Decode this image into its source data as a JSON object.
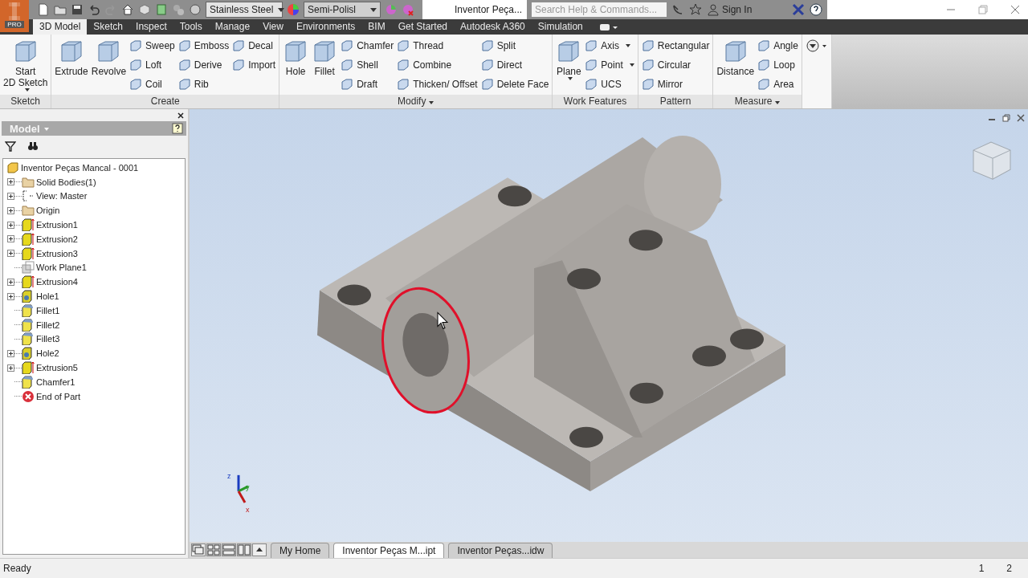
{
  "app": {
    "logo_badge": "PRO",
    "material": "Stainless Steel",
    "appearance": "Semi-Polisl",
    "title": "Inventor Peça...",
    "search_placeholder": "Search Help & Commands...",
    "sign_in": "Sign In"
  },
  "ribbon_tabs": [
    {
      "label": "3D Model",
      "selected": true
    },
    {
      "label": "Sketch",
      "selected": false
    },
    {
      "label": "Inspect",
      "selected": false
    },
    {
      "label": "Tools",
      "selected": false
    },
    {
      "label": "Manage",
      "selected": false
    },
    {
      "label": "View",
      "selected": false
    },
    {
      "label": "Environments",
      "selected": false
    },
    {
      "label": "BIM",
      "selected": false
    },
    {
      "label": "Get Started",
      "selected": false
    },
    {
      "label": "Autodesk A360",
      "selected": false
    },
    {
      "label": "Simulation",
      "selected": false
    }
  ],
  "ribbon_panels": [
    {
      "title": "Sketch",
      "menu": false,
      "tools": [
        {
          "label": "Start\n2D Sketch",
          "kind": "large",
          "dropdown": true
        }
      ]
    },
    {
      "title": "Create",
      "menu": false,
      "tools": [
        {
          "label": "Extrude",
          "kind": "large",
          "dropdown": false
        },
        {
          "label": "Revolve",
          "kind": "large",
          "dropdown": false
        },
        {
          "label": "Sweep",
          "kind": "small",
          "dropdown": false
        },
        {
          "label": "Loft",
          "kind": "small",
          "dropdown": false
        },
        {
          "label": "Coil",
          "kind": "small",
          "dropdown": false
        },
        {
          "label": "Emboss",
          "kind": "small",
          "dropdown": false
        },
        {
          "label": "Derive",
          "kind": "small",
          "dropdown": false
        },
        {
          "label": "Rib",
          "kind": "small",
          "dropdown": false
        },
        {
          "label": "Decal",
          "kind": "small",
          "dropdown": false
        },
        {
          "label": "Import",
          "kind": "small",
          "dropdown": false
        }
      ]
    },
    {
      "title": "Modify",
      "menu": true,
      "tools": [
        {
          "label": "Hole",
          "kind": "large",
          "dropdown": false
        },
        {
          "label": "Fillet",
          "kind": "large",
          "dropdown": false
        },
        {
          "label": "Chamfer",
          "kind": "small",
          "dropdown": false
        },
        {
          "label": "Shell",
          "kind": "small",
          "dropdown": false
        },
        {
          "label": "Draft",
          "kind": "small",
          "dropdown": false
        },
        {
          "label": "Thread",
          "kind": "small",
          "dropdown": false
        },
        {
          "label": "Combine",
          "kind": "small",
          "dropdown": false
        },
        {
          "label": "Thicken/ Offset",
          "kind": "small",
          "dropdown": false
        },
        {
          "label": "Split",
          "kind": "small",
          "dropdown": false
        },
        {
          "label": "Direct",
          "kind": "small",
          "dropdown": false
        },
        {
          "label": "Delete Face",
          "kind": "small",
          "dropdown": false
        }
      ]
    },
    {
      "title": "Work Features",
      "menu": false,
      "tools": [
        {
          "label": "Plane",
          "kind": "large",
          "dropdown": true
        },
        {
          "label": "Axis",
          "kind": "small",
          "dropdown": true
        },
        {
          "label": "Point",
          "kind": "small",
          "dropdown": true
        },
        {
          "label": "UCS",
          "kind": "small",
          "dropdown": false
        }
      ]
    },
    {
      "title": "Pattern",
      "menu": false,
      "tools": [
        {
          "label": "Rectangular",
          "kind": "small",
          "dropdown": false
        },
        {
          "label": "Circular",
          "kind": "small",
          "dropdown": false
        },
        {
          "label": "Mirror",
          "kind": "small",
          "dropdown": false
        }
      ]
    },
    {
      "title": "Measure",
      "menu": true,
      "tools": [
        {
          "label": "Distance",
          "kind": "large",
          "dropdown": false
        },
        {
          "label": "Angle",
          "kind": "small",
          "dropdown": false
        },
        {
          "label": "Loop",
          "kind": "small",
          "dropdown": false
        },
        {
          "label": "Area",
          "kind": "small",
          "dropdown": false
        }
      ]
    }
  ],
  "browser": {
    "title": "Model",
    "tree": {
      "label": "Inventor Peças Mancal - 0001",
      "kind": "part",
      "children": [
        {
          "label": "Solid Bodies(1)",
          "kind": "folder",
          "expandable": true
        },
        {
          "label": "View: Master",
          "kind": "view",
          "expandable": true
        },
        {
          "label": "Origin",
          "kind": "folder",
          "expandable": true
        },
        {
          "label": "Extrusion1",
          "kind": "extrusion",
          "expandable": true
        },
        {
          "label": "Extrusion2",
          "kind": "extrusion",
          "expandable": true
        },
        {
          "label": "Extrusion3",
          "kind": "extrusion",
          "expandable": true
        },
        {
          "label": "Work Plane1",
          "kind": "workplane",
          "expandable": false
        },
        {
          "label": "Extrusion4",
          "kind": "extrusion",
          "expandable": true
        },
        {
          "label": "Hole1",
          "kind": "hole",
          "expandable": true
        },
        {
          "label": "Fillet1",
          "kind": "fillet",
          "expandable": false
        },
        {
          "label": "Fillet2",
          "kind": "fillet",
          "expandable": false
        },
        {
          "label": "Fillet3",
          "kind": "fillet",
          "expandable": false
        },
        {
          "label": "Hole2",
          "kind": "hole",
          "expandable": true
        },
        {
          "label": "Extrusion5",
          "kind": "extrusion",
          "expandable": true
        },
        {
          "label": "Chamfer1",
          "kind": "fillet",
          "expandable": false
        },
        {
          "label": "End of Part",
          "kind": "end",
          "expandable": false
        }
      ]
    }
  },
  "triad_labels": [
    "z",
    "y",
    "x"
  ],
  "document_tabs": [
    {
      "label": "My Home",
      "selected": false
    },
    {
      "label": "Inventor Peças M...ipt",
      "selected": true
    },
    {
      "label": "Inventor Peças...idw",
      "selected": false
    }
  ],
  "status_bar": {
    "text": "Ready",
    "pages": [
      "1",
      "2"
    ]
  }
}
